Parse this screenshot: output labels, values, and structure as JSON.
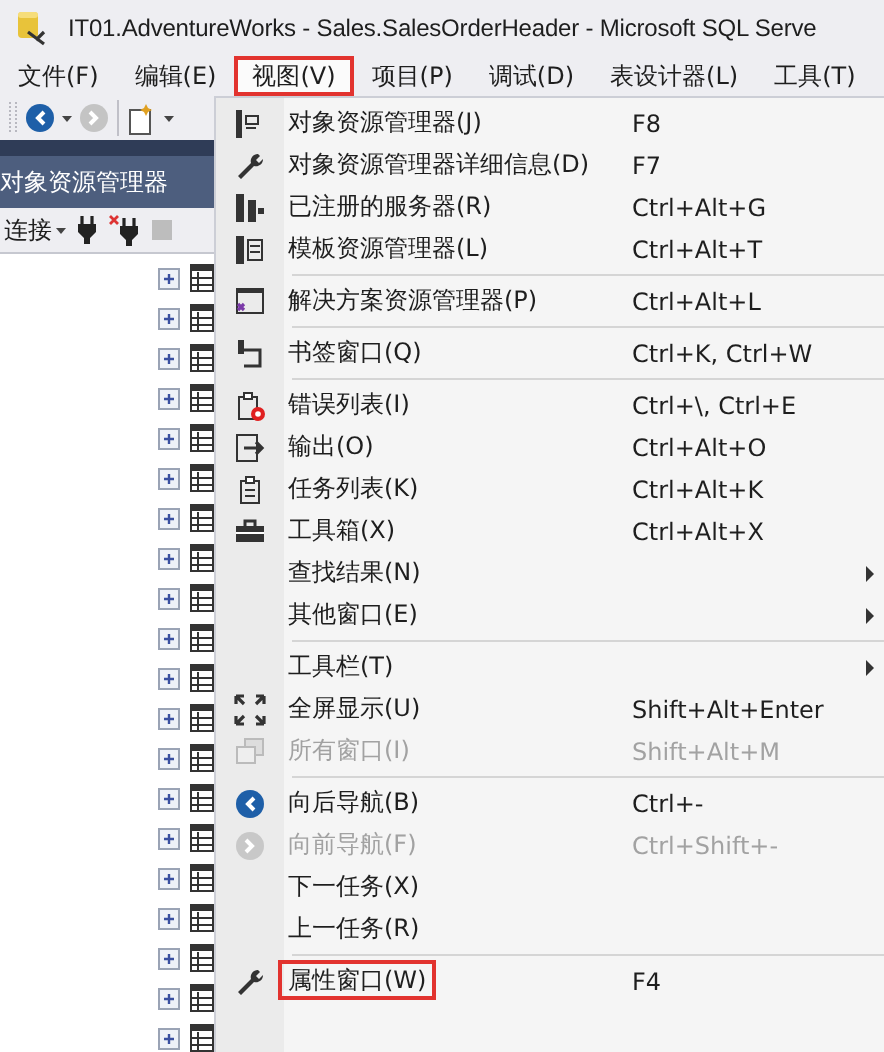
{
  "window": {
    "title": "IT01.AdventureWorks - Sales.SalesOrderHeader - Microsoft SQL Serve"
  },
  "menubar": [
    {
      "label": "文件(F)",
      "selected": false
    },
    {
      "label": "编辑(E)",
      "selected": false
    },
    {
      "label": "视图(V)",
      "selected": true
    },
    {
      "label": "项目(P)",
      "selected": false
    },
    {
      "label": "调试(D)",
      "selected": false
    },
    {
      "label": "表设计器(L)",
      "selected": false
    },
    {
      "label": "工具(T)",
      "selected": false
    }
  ],
  "explorer": {
    "title": "对象资源管理器",
    "connect": "连接",
    "tree": [
      {
        "expanded": false
      },
      {
        "expanded": false
      },
      {
        "expanded": false
      },
      {
        "expanded": false
      },
      {
        "expanded": false
      },
      {
        "expanded": false
      },
      {
        "expanded": false
      },
      {
        "expanded": false
      },
      {
        "expanded": false
      },
      {
        "expanded": false
      },
      {
        "expanded": false
      },
      {
        "expanded": false
      },
      {
        "expanded": false
      },
      {
        "expanded": false
      },
      {
        "expanded": false
      },
      {
        "expanded": false
      },
      {
        "expanded": false
      },
      {
        "expanded": false
      },
      {
        "expanded": false
      },
      {
        "expanded": false
      }
    ]
  },
  "view_menu": [
    {
      "kind": "item",
      "label": "对象资源管理器(J)",
      "shortcut": "F8",
      "disabled": false,
      "submenu": false,
      "marked": false
    },
    {
      "kind": "item",
      "label": "对象资源管理器详细信息(D)",
      "shortcut": "F7",
      "disabled": false,
      "submenu": false,
      "marked": false
    },
    {
      "kind": "item",
      "label": "已注册的服务器(R)",
      "shortcut": "Ctrl+Alt+G",
      "disabled": false,
      "submenu": false,
      "marked": false
    },
    {
      "kind": "item",
      "label": "模板资源管理器(L)",
      "shortcut": "Ctrl+Alt+T",
      "disabled": false,
      "submenu": false,
      "marked": false
    },
    {
      "kind": "separator"
    },
    {
      "kind": "item",
      "label": "解决方案资源管理器(P)",
      "shortcut": "Ctrl+Alt+L",
      "disabled": false,
      "submenu": false,
      "marked": false
    },
    {
      "kind": "separator"
    },
    {
      "kind": "item",
      "label": "书签窗口(Q)",
      "shortcut": "Ctrl+K, Ctrl+W",
      "disabled": false,
      "submenu": false,
      "marked": false
    },
    {
      "kind": "separator"
    },
    {
      "kind": "item",
      "label": "错误列表(I)",
      "shortcut": "Ctrl+\\, Ctrl+E",
      "disabled": false,
      "submenu": false,
      "marked": false
    },
    {
      "kind": "item",
      "label": "输出(O)",
      "shortcut": "Ctrl+Alt+O",
      "disabled": false,
      "submenu": false,
      "marked": false
    },
    {
      "kind": "item",
      "label": "任务列表(K)",
      "shortcut": "Ctrl+Alt+K",
      "disabled": false,
      "submenu": false,
      "marked": false
    },
    {
      "kind": "item",
      "label": "工具箱(X)",
      "shortcut": "Ctrl+Alt+X",
      "disabled": false,
      "submenu": false,
      "marked": false
    },
    {
      "kind": "item",
      "label": "查找结果(N)",
      "disabled": false,
      "submenu": true,
      "marked": false
    },
    {
      "kind": "item",
      "label": "其他窗口(E)",
      "disabled": false,
      "submenu": true,
      "marked": false
    },
    {
      "kind": "separator"
    },
    {
      "kind": "item",
      "label": "工具栏(T)",
      "disabled": false,
      "submenu": true,
      "marked": false
    },
    {
      "kind": "item",
      "label": "全屏显示(U)",
      "shortcut": "Shift+Alt+Enter",
      "disabled": false,
      "submenu": false,
      "marked": false
    },
    {
      "kind": "item",
      "label": "所有窗口(I)",
      "shortcut": "Shift+Alt+M",
      "disabled": true,
      "submenu": false,
      "marked": false
    },
    {
      "kind": "separator"
    },
    {
      "kind": "item",
      "label": "向后导航(B)",
      "shortcut": "Ctrl+-",
      "disabled": false,
      "submenu": false,
      "marked": false
    },
    {
      "kind": "item",
      "label": "向前导航(F)",
      "shortcut": "Ctrl+Shift+-",
      "disabled": true,
      "submenu": false,
      "marked": false
    },
    {
      "kind": "item",
      "label": "下一任务(X)",
      "disabled": false,
      "submenu": false,
      "marked": false
    },
    {
      "kind": "item",
      "label": "上一任务(R)",
      "disabled": false,
      "submenu": false,
      "marked": false
    },
    {
      "kind": "separator"
    },
    {
      "kind": "item",
      "label": "属性窗口(W)",
      "shortcut": "F4",
      "disabled": false,
      "submenu": false,
      "marked": true
    }
  ]
}
